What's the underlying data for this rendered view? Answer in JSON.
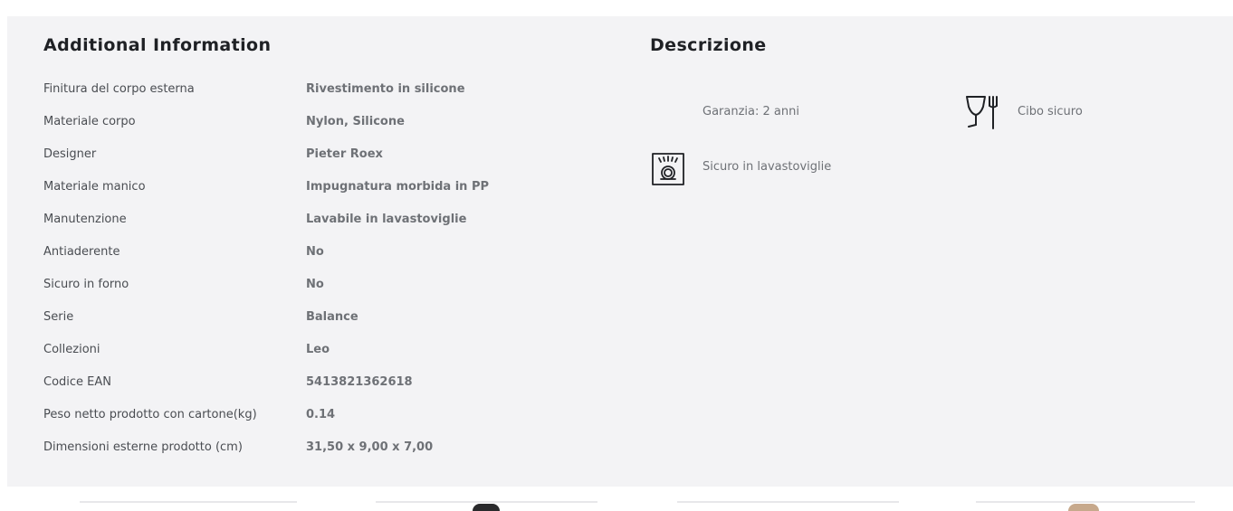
{
  "additional": {
    "title": "Additional Information",
    "rows": [
      {
        "label": "Finitura del corpo esterna",
        "value": "Rivestimento in silicone"
      },
      {
        "label": "Materiale corpo",
        "value": "Nylon, Silicone"
      },
      {
        "label": "Designer",
        "value": "Pieter Roex"
      },
      {
        "label": "Materiale manico",
        "value": "Impugnatura morbida in PP"
      },
      {
        "label": "Manutenzione",
        "value": "Lavabile in lavastoviglie"
      },
      {
        "label": "Antiaderente",
        "value": "No"
      },
      {
        "label": "Sicuro in forno",
        "value": "No"
      },
      {
        "label": "Serie",
        "value": "Balance"
      },
      {
        "label": "Collezioni",
        "value": "Leo"
      },
      {
        "label": "Codice EAN",
        "value": "5413821362618"
      },
      {
        "label": "Peso netto prodotto con cartone(kg)",
        "value": "0.14"
      },
      {
        "label": "Dimensioni esterne prodotto (cm)",
        "value": "31,50 x 9,00 x 7,00"
      }
    ]
  },
  "descrizione": {
    "title": "Descrizione",
    "features": [
      {
        "text": "Garanzia: 2 anni",
        "icon": "none"
      },
      {
        "text": "Cibo sicuro",
        "icon": "glass-fork-icon"
      },
      {
        "text": "Sicuro in lavastoviglie",
        "icon": "dishwasher-icon"
      }
    ]
  },
  "colors": {
    "panel_bg": "#f3f3f5",
    "heading": "#1f2125",
    "label": "#4a4d52",
    "value": "#6e7176"
  }
}
